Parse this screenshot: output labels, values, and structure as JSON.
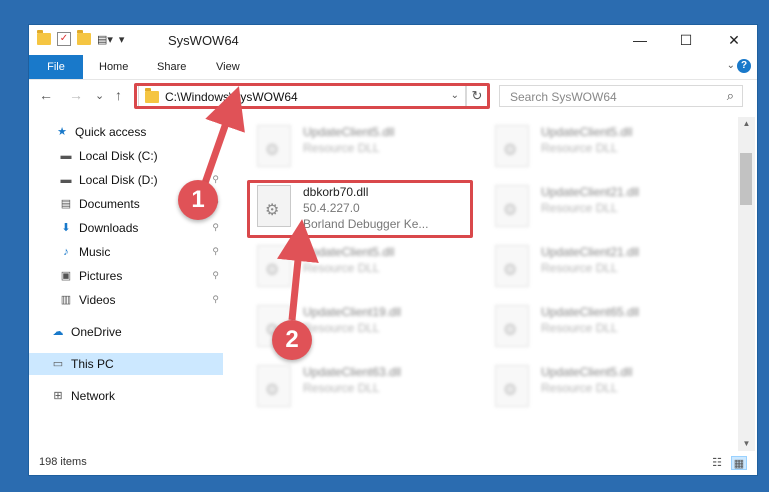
{
  "window": {
    "title": "SysWOW64",
    "controls": {
      "minimize": "—",
      "maximize": "☐",
      "close": "✕"
    }
  },
  "ribbon": {
    "tabs": [
      "File",
      "Home",
      "Share",
      "View"
    ],
    "help": "?"
  },
  "nav": {
    "back": "←",
    "forward": "→",
    "recent": "⌄",
    "up": "↑",
    "address": "C:\\Windows\\SysWOW64",
    "address_dropdown": "⌄",
    "refresh": "↻",
    "search_placeholder": "Search SysWOW64",
    "search_icon": "⌕"
  },
  "sidebar": {
    "items": [
      {
        "label": "Quick access",
        "icon": "star-icon",
        "glyph": "★",
        "pinned": false
      },
      {
        "label": "Local Disk (C:)",
        "icon": "drive-icon",
        "glyph": "▬",
        "pinned": false
      },
      {
        "label": "Local Disk (D:)",
        "icon": "drive-icon",
        "glyph": "▬",
        "pinned": true
      },
      {
        "label": "Documents",
        "icon": "documents-icon",
        "glyph": "▤",
        "pinned": true
      },
      {
        "label": "Downloads",
        "icon": "download-icon",
        "glyph": "⬇",
        "pinned": true
      },
      {
        "label": "Music",
        "icon": "music-icon",
        "glyph": "♪",
        "pinned": true
      },
      {
        "label": "Pictures",
        "icon": "pictures-icon",
        "glyph": "▣",
        "pinned": true
      },
      {
        "label": "Videos",
        "icon": "videos-icon",
        "glyph": "▥",
        "pinned": true
      },
      {
        "label": "OneDrive",
        "icon": "cloud-icon",
        "glyph": "☁",
        "pinned": false
      },
      {
        "label": "This PC",
        "icon": "computer-icon",
        "glyph": "▭",
        "pinned": false
      },
      {
        "label": "Network",
        "icon": "network-icon",
        "glyph": "⊞",
        "pinned": false
      }
    ],
    "pin_glyph": "📌"
  },
  "files": [
    {
      "name": "UpdateClient5.dll",
      "type": "Resource DLL",
      "extra": "",
      "highlighted": false
    },
    {
      "name": "UpdateClient5.dll",
      "type": "Resource DLL",
      "extra": "",
      "highlighted": false
    },
    {
      "name": "dbkorb70.dll",
      "type": "50.4.227.0",
      "extra": "Borland Debugger Ke...",
      "highlighted": true
    },
    {
      "name": "UpdateClient21.dll",
      "type": "Resource DLL",
      "extra": "",
      "highlighted": false
    },
    {
      "name": "UpdateClient5.dll",
      "type": "Resource DLL",
      "extra": "",
      "highlighted": false
    },
    {
      "name": "UpdateClient21.dll",
      "type": "Resource DLL",
      "extra": "",
      "highlighted": false
    },
    {
      "name": "UpdateClient19.dll",
      "type": "Resource DLL",
      "extra": "",
      "highlighted": false
    },
    {
      "name": "UpdateClient65.dll",
      "type": "Resource DLL",
      "extra": "",
      "highlighted": false
    },
    {
      "name": "UpdateClient63.dll",
      "type": "Resource DLL",
      "extra": "",
      "highlighted": false
    },
    {
      "name": "UpdateClient5.dll",
      "type": "Resource DLL",
      "extra": "",
      "highlighted": false
    }
  ],
  "status": {
    "count": "198 items"
  },
  "annotations": {
    "step1": "1",
    "step2": "2"
  },
  "colors": {
    "accent": "#1979ca",
    "highlight": "#d9484b",
    "selection": "#cce8ff"
  }
}
